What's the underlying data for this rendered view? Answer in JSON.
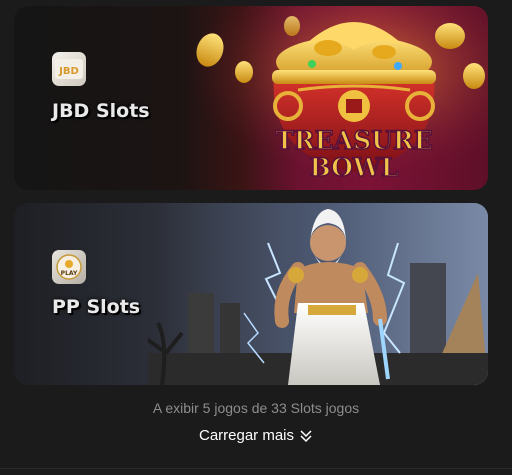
{
  "providers": [
    {
      "name": "JBD Slots",
      "logo_text": "JBD",
      "banner_title_line1": "TREASURE",
      "banner_title_line2": "BOWL"
    },
    {
      "name": "PP Slots",
      "logo_text": "PLAY"
    }
  ],
  "footer": {
    "status_text": "A exibir 5 jogos de 33 Slots jogos",
    "load_more_label": "Carregar mais",
    "load_more_icon": "double-chevron-down-icon"
  },
  "colors": {
    "background": "#1b1b1b",
    "text_muted": "#8d8d8d",
    "text_primary": "#ffffff",
    "gold": "#f1b72b"
  }
}
